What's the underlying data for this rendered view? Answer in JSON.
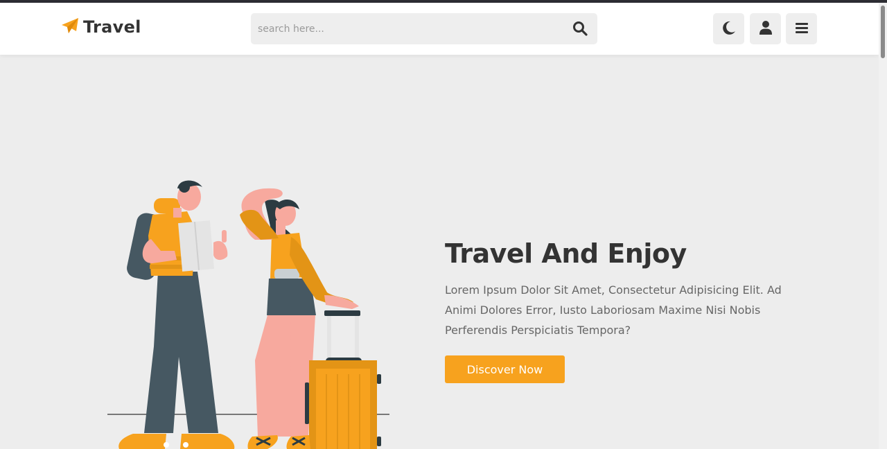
{
  "header": {
    "logo_text": "Travel",
    "search_placeholder": "search here...",
    "buttons": {
      "theme": "moon-icon",
      "login": "user-icon",
      "menu": "bars-icon"
    }
  },
  "hero": {
    "title": "Travel And Enjoy",
    "description": "Lorem Ipsum Dolor Sit Amet, Consectetur Adipisicing Elit. Ad Animi Dolores Error, Iusto Laboriosam Maxime Nisi Nobis Perferendis Perspiciatis Tempora?",
    "cta_label": "Discover Now"
  },
  "colors": {
    "accent": "#f7a21e",
    "text_dark": "#333333",
    "text_body": "#666666",
    "background": "#ededed",
    "header_bg": "#ffffff"
  }
}
